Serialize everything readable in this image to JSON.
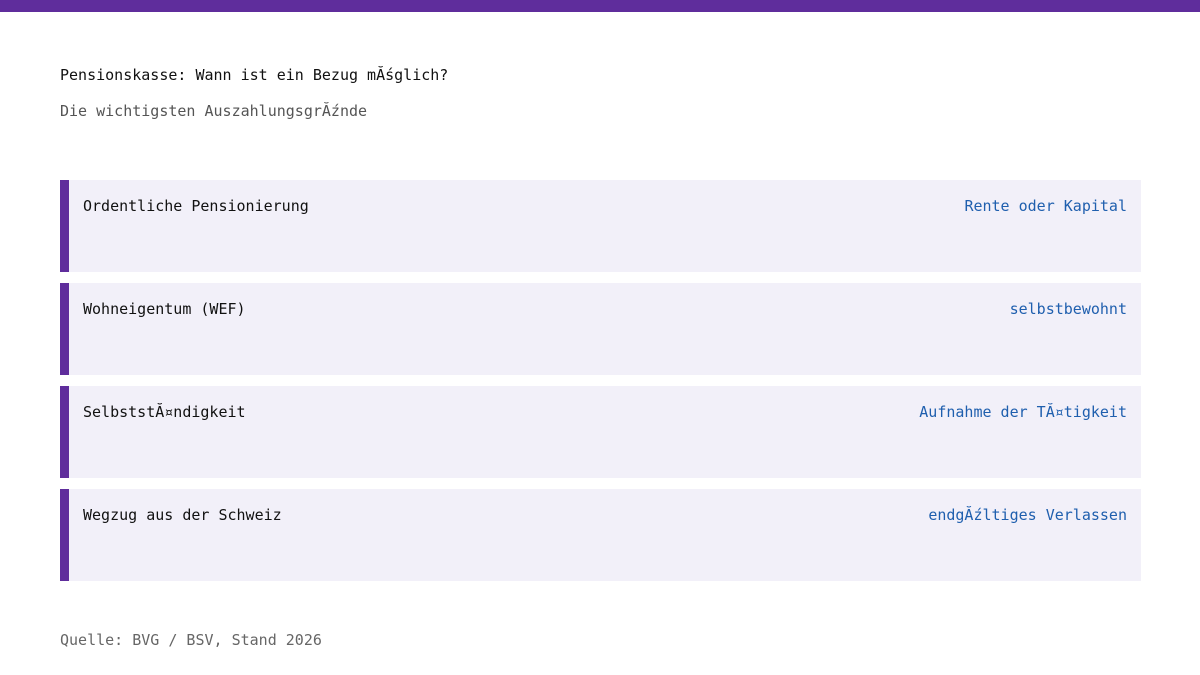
{
  "header": {
    "title": "Pensionskasse: Wann ist ein Bezug mĂśglich?",
    "subtitle": "Die wichtigsten AuszahlungsgrĂźnde"
  },
  "items": [
    {
      "label": "Ordentliche Pensionierung",
      "value": "Rente oder Kapital"
    },
    {
      "label": "Wohneigentum (WEF)",
      "value": "selbstbewohnt"
    },
    {
      "label": "SelbststĂ¤ndigkeit",
      "value": "Aufnahme der TĂ¤tigkeit"
    },
    {
      "label": "Wegzug aus der Schweiz",
      "value": "endgĂźltiges Verlassen"
    }
  ],
  "footer": {
    "source": "Quelle: BVG / BSV, Stand 2026"
  },
  "colors": {
    "accent": "#5f2d9c",
    "card_background": "#f2f0f9",
    "value_text": "#1f5fae"
  }
}
